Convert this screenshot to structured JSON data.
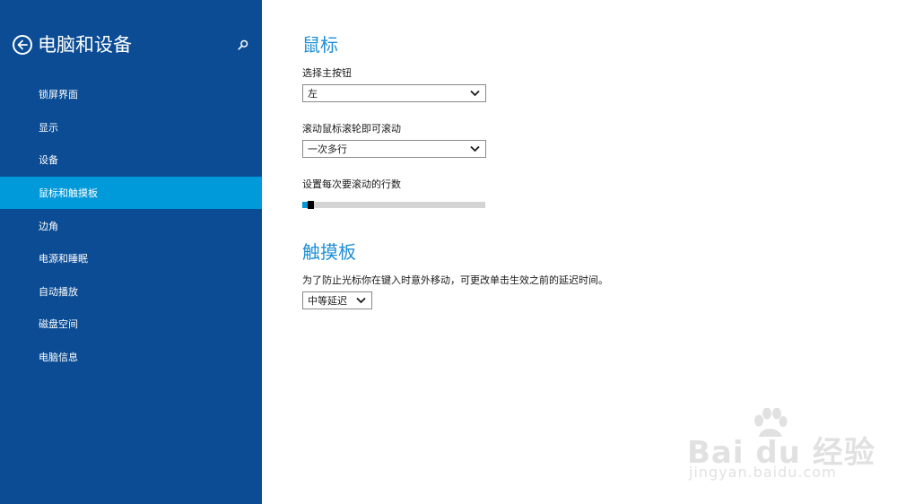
{
  "sidebar": {
    "title": "电脑和设备",
    "back_icon": "back-arrow-icon",
    "search_icon": "search-icon",
    "items": [
      {
        "label": "锁屏界面"
      },
      {
        "label": "显示"
      },
      {
        "label": "设备"
      },
      {
        "label": "鼠标和触摸板",
        "active": true
      },
      {
        "label": "边角"
      },
      {
        "label": "电源和睡眠"
      },
      {
        "label": "自动播放"
      },
      {
        "label": "磁盘空间"
      },
      {
        "label": "电脑信息"
      }
    ]
  },
  "mouse": {
    "title": "鼠标",
    "primary_button_label": "选择主按钮",
    "primary_button_value": "左",
    "scroll_label": "滚动鼠标滚轮即可滚动",
    "scroll_value": "一次多行",
    "lines_label": "设置每次要滚动的行数",
    "lines_level": 0.03
  },
  "touchpad": {
    "title": "触摸板",
    "delay_label": "为了防止光标你在键入时意外移动，可更改单击生效之前的延迟时间。",
    "delay_value": "中等延迟"
  },
  "watermark": {
    "line1": "Bai du 经验",
    "line2": "jingyan.baidu.com"
  },
  "colors": {
    "sidebar_bg": "#0b4c94",
    "active_item_bg": "#0099d9",
    "accent_title": "#1e8fd6"
  }
}
